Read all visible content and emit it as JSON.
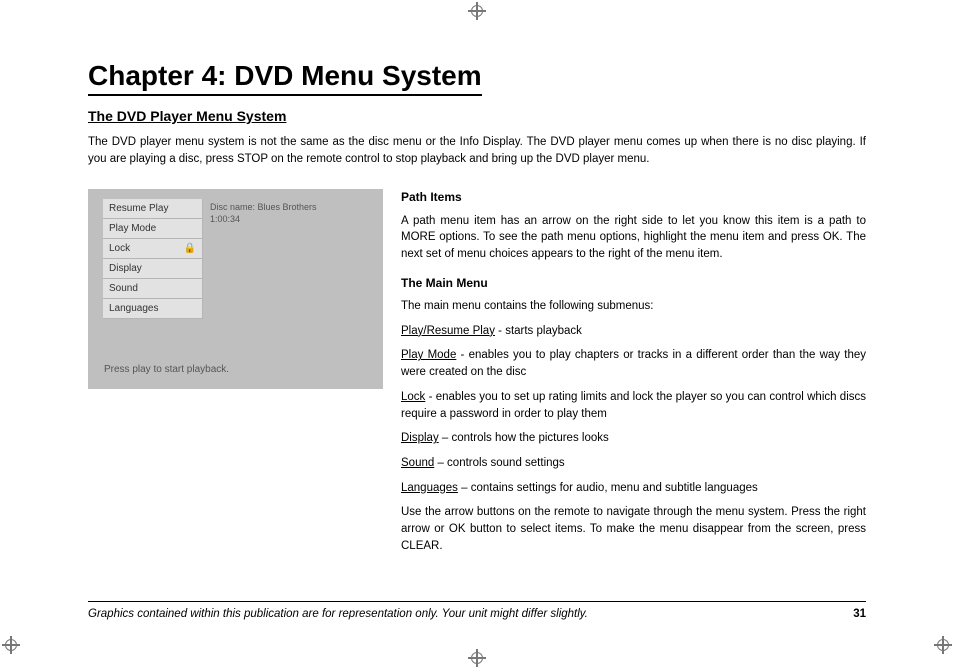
{
  "chapter": {
    "title": "Chapter 4: DVD Menu System",
    "section": "The DVD Player Menu System",
    "intro": "The DVD player menu system is not the same as the disc menu or the Info Display. The DVD player menu comes up when there is no disc playing. If you are playing a disc, press STOP on the remote control to stop playback and bring up the DVD player menu."
  },
  "figure": {
    "menu_items": {
      "0": "Resume Play",
      "1": "Play Mode",
      "2": "Lock",
      "3": "Display",
      "4": "Sound",
      "5": "Languages"
    },
    "disc_name_label": "Disc name: Blues Brothers",
    "disc_time": "1:00:34",
    "caption": "Press play to start playback."
  },
  "right": {
    "path_heading": "Path Items",
    "path_body": "A path menu item has an arrow on the right side to let you know this item is a path to MORE options. To see the path menu options, highlight the menu item and press OK. The next set of menu choices appears to the right of the menu item.",
    "main_heading": "The Main Menu",
    "main_body": "The main menu contains the following submenus:",
    "items": {
      "play": {
        "label": "Play/Resume Play",
        "desc": " - starts playback"
      },
      "playmode": {
        "label": "Play Mode",
        "desc": " - enables you to play chapters or tracks in a different order than the way they were created on the disc"
      },
      "lock": {
        "label": "Lock",
        "desc": " - enables you to set up rating limits and lock the player so you can control which discs require a password in order to play them"
      },
      "display": {
        "label": "Display",
        "desc": " – controls how the pictures looks"
      },
      "sound": {
        "label": "Sound",
        "desc": " – controls sound settings"
      },
      "languages": {
        "label": "Languages",
        "desc": " – contains settings for audio, menu and subtitle languages"
      }
    },
    "nav_note": "Use the arrow buttons on the remote to navigate through the menu system. Press the right arrow or OK button to select items. To make the menu disappear from the screen, press CLEAR."
  },
  "footer": {
    "note": "Graphics contained within this publication are for representation only. Your unit might differ slightly.",
    "page": "31"
  }
}
